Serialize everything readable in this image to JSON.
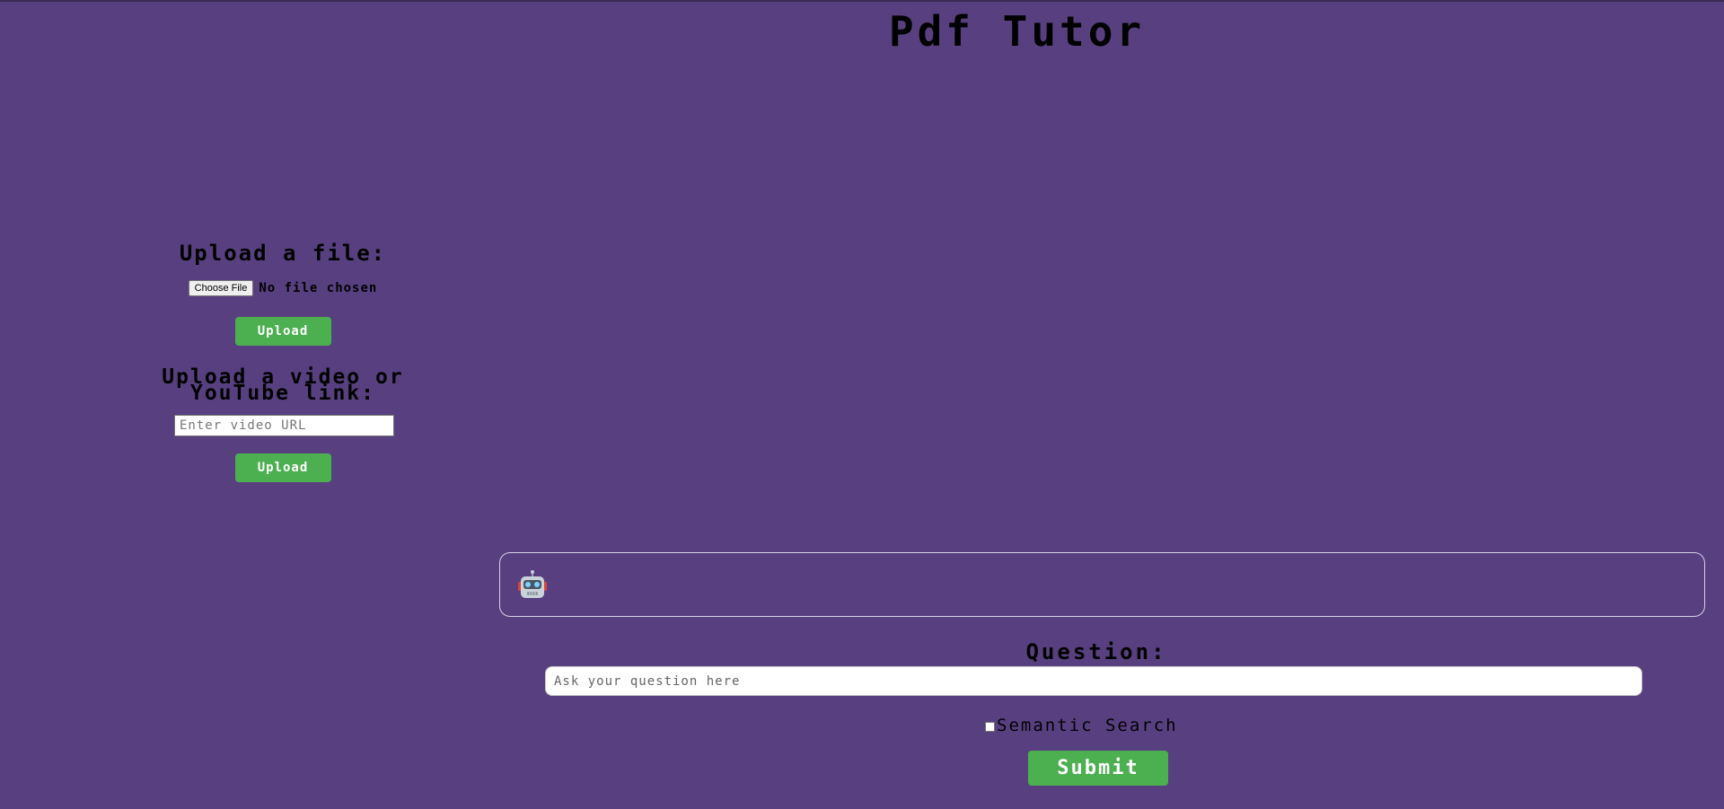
{
  "page": {
    "title": "Pdf Tutor"
  },
  "file_upload": {
    "heading": "Upload a file:",
    "choose_label": "Choose File",
    "status": "No file chosen",
    "button_label": "Upload"
  },
  "video_upload": {
    "heading_line1": "Upload a video or",
    "heading_line2": "YouTube link:",
    "placeholder": "Enter video URL",
    "button_label": "Upload"
  },
  "chat": {
    "bot_icon": "robot-icon"
  },
  "question": {
    "label": "Question:",
    "placeholder": "Ask your question here",
    "semantic_label": "Semantic Search",
    "semantic_checked": false,
    "submit_label": "Submit"
  },
  "colors": {
    "background": "#584080",
    "button": "#4caf50"
  }
}
